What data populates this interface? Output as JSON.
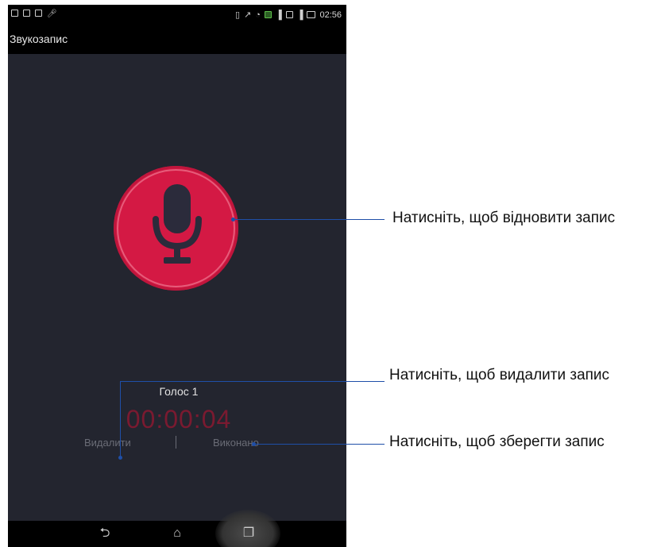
{
  "status_bar": {
    "left_icons": [
      "calendar-icon",
      "document-icon",
      "window-icon",
      "microphone-icon"
    ],
    "right_icons": [
      "vibrate-icon",
      "no-sync-icon",
      "wifi-icon",
      "sim1-icon",
      "signal-icon",
      "sim2-icon",
      "signal-icon",
      "battery-icon"
    ],
    "time": "02:56"
  },
  "app": {
    "title": "Звукозапис"
  },
  "recorder": {
    "record_button_icon": "microphone-icon",
    "record_button_color": "#d41944",
    "recording_name": "Голос 1",
    "elapsed_time": "00:00:04",
    "delete_label": "Видалити",
    "done_label": "Виконано"
  },
  "nav_bar": {
    "back_icon": "back-icon",
    "home_icon": "home-icon",
    "recents_icon": "recents-icon"
  },
  "callouts": {
    "resume": "Натисніть, щоб відновити запис",
    "delete": "Натисніть, щоб видалити запис",
    "save": "Натисніть, щоб зберегти запис"
  }
}
